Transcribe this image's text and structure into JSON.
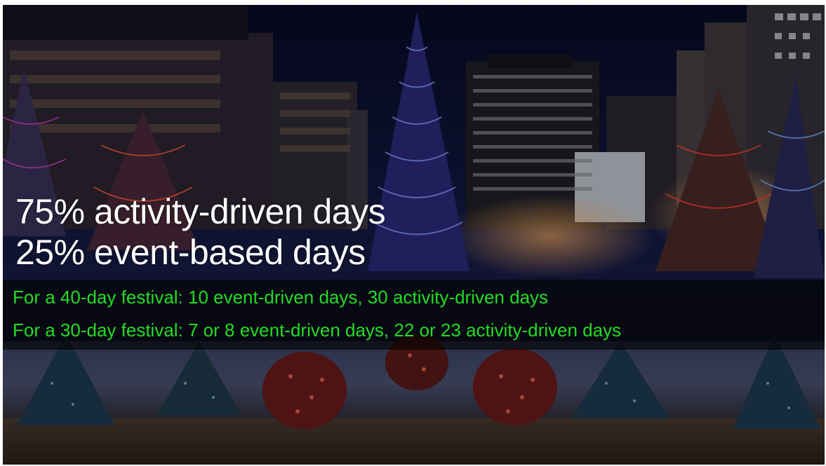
{
  "slide": {
    "headline_1": "75% activity-driven days",
    "headline_2": "25% event-based days",
    "detail_1": "For a 40-day festival: 10 event-driven days, 30 activity-driven days",
    "detail_2": "For a 30-day festival: 7 or 8 event-driven days, 22 or 23 activity-driven days"
  },
  "colors": {
    "headline_text": "#ffffff",
    "detail_text": "#22dd22",
    "band_overlay": "#000000",
    "sky": "#0b1030"
  },
  "background": {
    "icon": "night-city-christmas-lights-photo"
  }
}
